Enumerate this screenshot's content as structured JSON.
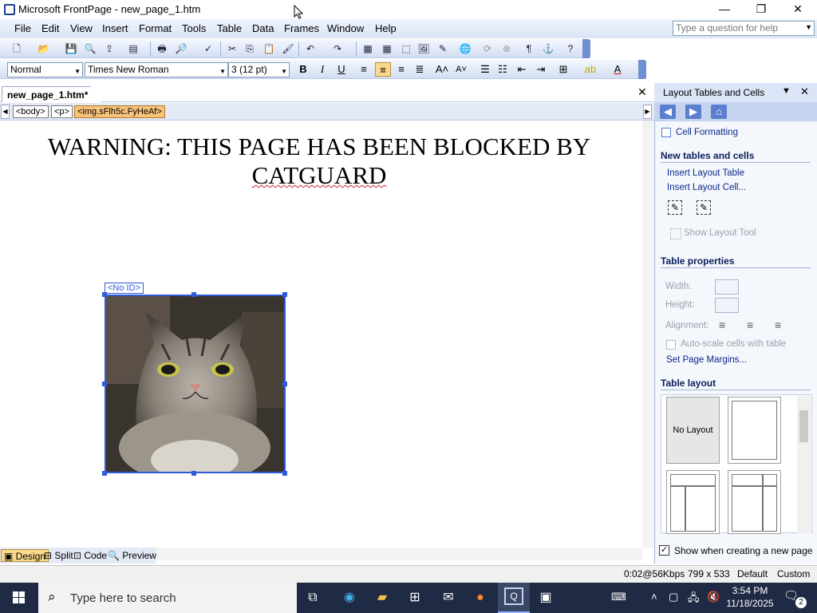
{
  "window": {
    "title": "Microsoft FrontPage - new_page_1.htm",
    "minimize": "—",
    "restore": "❐",
    "close": "✕"
  },
  "menu": [
    "File",
    "Edit",
    "View",
    "Insert",
    "Format",
    "Tools",
    "Table",
    "Data",
    "Frames",
    "Window",
    "Help"
  ],
  "help_box": {
    "placeholder": "Type a question for help"
  },
  "format_bar": {
    "style": "Normal",
    "font": "Times New Roman",
    "size": "3 (12 pt)",
    "bold": "B",
    "italic": "I",
    "underline": "U"
  },
  "document": {
    "tab": "new_page_1.htm*",
    "close": "✕",
    "tags": [
      "<body>",
      "<p>",
      "<img.sFlh5c.FyHeAf>"
    ],
    "heading_line1": "WARNING: THIS PAGE HAS BEEN BLOCKED BY",
    "heading_line2": "CATGUARD",
    "image_label": "<No ID>"
  },
  "view_tabs": [
    "Design",
    "Split",
    "Code",
    "Preview"
  ],
  "task_pane": {
    "title": "Layout Tables and Cells",
    "cell_formatting": "Cell Formatting",
    "new_tables_header": "New tables and cells",
    "insert_layout_table": "Insert Layout Table",
    "insert_layout_cell": "Insert Layout Cell...",
    "show_layout_tool": "Show Layout Tool",
    "table_properties_header": "Table properties",
    "width_label": "Width:",
    "height_label": "Height:",
    "alignment_label": "Alignment:",
    "autoscale": "Auto-scale cells with table",
    "set_margins": "Set Page Margins...",
    "table_layout_header": "Table layout",
    "no_layout": "No Layout",
    "show_when_creating": "Show when creating a new page"
  },
  "status_bar": {
    "speed": "0:02@56Kbps",
    "dims": "799 x 533",
    "default": "Default",
    "custom": "Custom"
  },
  "taskbar": {
    "search_placeholder": "Type here to search",
    "time": "3:54 PM",
    "date": "11/18/2025",
    "notifications": "2"
  },
  "colors": {
    "selection_blue": "#2f5bd7",
    "toolbar_top": "#f4f7fd",
    "toolbar_bottom": "#d3def4",
    "taskbar": "#1f2a44",
    "active_tab": "#fbd98a"
  }
}
